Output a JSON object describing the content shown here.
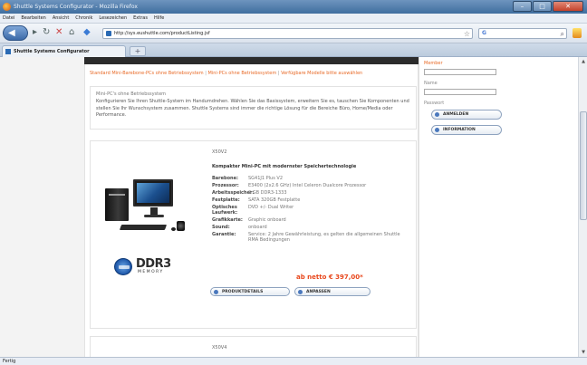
{
  "window": {
    "title": "Shuttle Systems Configurator - Mozilla Firefox"
  },
  "menu": [
    "Datei",
    "Bearbeiten",
    "Ansicht",
    "Chronik",
    "Lesezeichen",
    "Extras",
    "Hilfe"
  ],
  "address": {
    "url": "http://sys.eushuttle.com/productListing.jsf"
  },
  "tab": {
    "label": "Shuttle Systems Configurator",
    "new_tab": "+"
  },
  "breadcrumb": {
    "items": [
      "Standard Mini-Barebone-PCs ohne Betriebssystem",
      "Mini-PCs ohne Betriebssystem",
      "Verfügbare Modelle bitte auswählen"
    ],
    "separator": "|"
  },
  "intro": {
    "title": "Mini-PC's ohne Betriebssystem",
    "text": "Konfigurieren Sie Ihren Shuttle-System im Handumdrehen. Wählen Sie das Basissystem, erweitern Sie es, tauschen Sie Komponenten und stellen Sie Ihr Wunschsystem zusammen. Shuttle Systems sind immer die richtige Lösung für die Bereiche Büro, Home/Media oder Performance."
  },
  "product": {
    "name": "X50V2",
    "subtitle": "Kompakter Mini-PC mit modernster Speichertechnologie",
    "specs": [
      {
        "label": "Barebone:",
        "value": "SG41J1 Plus V2"
      },
      {
        "label": "Prozessor:",
        "value": "E3400 (2x2.6 GHz) Intel Celeron Dualcore Prozessor"
      },
      {
        "label": "Arbeitsspeicher:",
        "value": "2 GB DDR3-1333"
      },
      {
        "label": "Festplatte:",
        "value": "SATA 320GB Festplatte"
      },
      {
        "label": "Optisches Laufwerk:",
        "value": "DVD +/- Dual Writer"
      },
      {
        "label": "Grafikkarte:",
        "value": "Graphic onboard"
      },
      {
        "label": "Sound:",
        "value": "onboard"
      },
      {
        "label": "Garantie:",
        "value": "Service: 2 Jahre Gewährleistung, es gelten die allgemeinen Shuttle RMA Bedingungen"
      }
    ],
    "price": "ab netto € 397,00*",
    "details_button": "PRODUKTDETAILS",
    "customize_button": "ANPASSEN",
    "badge": {
      "ddr": "DDR3",
      "ddr_sub": "MEMORY"
    }
  },
  "product2": {
    "name": "X50V4"
  },
  "sidebar": {
    "member_label": "Member",
    "name_label": "Name",
    "password_label": "Passwort",
    "login_button": "ANMELDEN",
    "info_button": "INFORMATION"
  },
  "status": {
    "text": "Fertig"
  },
  "colors": {
    "accent_orange": "#e86a27",
    "price_red": "#e8471c",
    "titlebar_blue": "#3f6e9f"
  }
}
